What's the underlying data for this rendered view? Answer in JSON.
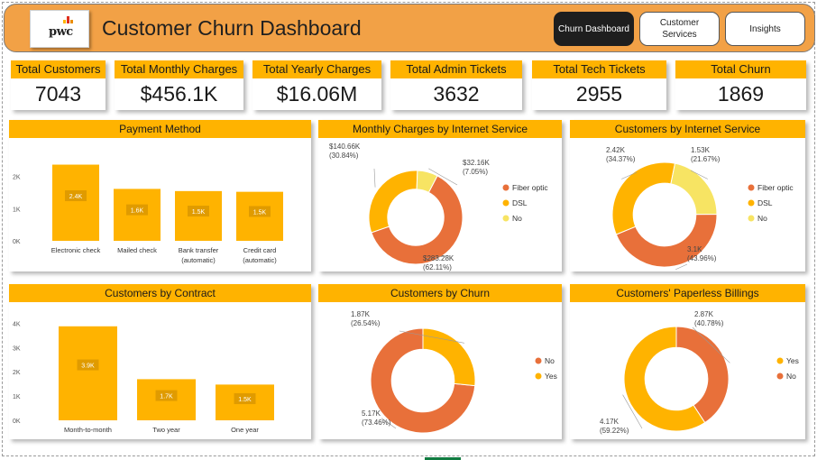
{
  "header": {
    "logo_text": "pwc",
    "title": "Customer Churn Dashboard",
    "nav": [
      {
        "label": "Churn Dashboard",
        "active": true
      },
      {
        "label": "Customer Services",
        "active": false
      },
      {
        "label": "Insights",
        "active": false
      }
    ]
  },
  "kpis": [
    {
      "label": "Total Customers",
      "value": "7043"
    },
    {
      "label": "Total Monthly Charges",
      "value": "$456.1K"
    },
    {
      "label": "Total Yearly Charges",
      "value": "$16.06M"
    },
    {
      "label": "Total Admin Tickets",
      "value": "3632"
    },
    {
      "label": "Total Tech Tickets",
      "value": "2955"
    },
    {
      "label": "Total Churn",
      "value": "1869"
    }
  ],
  "colors": {
    "accent": "#ffb300",
    "header_bg": "#f2a146",
    "orange_red": "#e8703a",
    "light_yellow": "#f7e463"
  },
  "chart_data": [
    {
      "id": "payment",
      "type": "bar",
      "title": "Payment Method",
      "categories": [
        "Electronic check",
        "Mailed check",
        "Bank transfer\n(automatic)",
        "Credit card\n(automatic)"
      ],
      "values": [
        2365,
        1612,
        1544,
        1522
      ],
      "data_labels": [
        "2.4K",
        "1.6K",
        "1.5K",
        "1.5K"
      ],
      "yticks": [
        "0K",
        "1K",
        "2K"
      ],
      "ylim": [
        0,
        2800
      ]
    },
    {
      "id": "contract",
      "type": "bar",
      "title": "Customers by Contract",
      "categories": [
        "Month-to-month",
        "Two year",
        "One year"
      ],
      "values": [
        3875,
        1695,
        1473
      ],
      "data_labels": [
        "3.9K",
        "1.7K",
        "1.5K"
      ],
      "yticks": [
        "0K",
        "1K",
        "2K",
        "3K",
        "4K"
      ],
      "ylim": [
        0,
        4350
      ]
    },
    {
      "id": "monthly_internet",
      "type": "pie",
      "title": "Monthly Charges by Internet Service",
      "slices": [
        {
          "name": "Fiber optic",
          "value": 62.11,
          "label": "$283.28K (62.11%)"
        },
        {
          "name": "DSL",
          "value": 30.84,
          "label": "$140.66K (30.84%)"
        },
        {
          "name": "No",
          "value": 7.05,
          "label": "$32.16K (7.05%)"
        }
      ],
      "legend": [
        "Fiber optic",
        "DSL",
        "No"
      ]
    },
    {
      "id": "customers_internet",
      "type": "pie",
      "title": "Customers by Internet Service",
      "slices": [
        {
          "name": "Fiber optic",
          "value": 43.96,
          "label": "3.1K (43.96%)"
        },
        {
          "name": "DSL",
          "value": 34.37,
          "label": "2.42K (34.37%)"
        },
        {
          "name": "No",
          "value": 21.67,
          "label": "1.53K (21.67%)"
        }
      ],
      "legend": [
        "Fiber optic",
        "DSL",
        "No"
      ]
    },
    {
      "id": "churn",
      "type": "pie",
      "title": "Customers by Churn",
      "slices": [
        {
          "name": "No",
          "value": 73.46,
          "label": "5.17K (73.46%)"
        },
        {
          "name": "Yes",
          "value": 26.54,
          "label": "1.87K (26.54%)"
        }
      ],
      "legend": [
        "No",
        "Yes"
      ]
    },
    {
      "id": "paperless",
      "type": "pie",
      "title": "Customers' Paperless Billings",
      "slices": [
        {
          "name": "Yes",
          "value": 59.22,
          "label": "4.17K (59.22%)"
        },
        {
          "name": "No",
          "value": 40.78,
          "label": "2.87K (40.78%)"
        }
      ],
      "legend": [
        "Yes",
        "No"
      ]
    }
  ]
}
